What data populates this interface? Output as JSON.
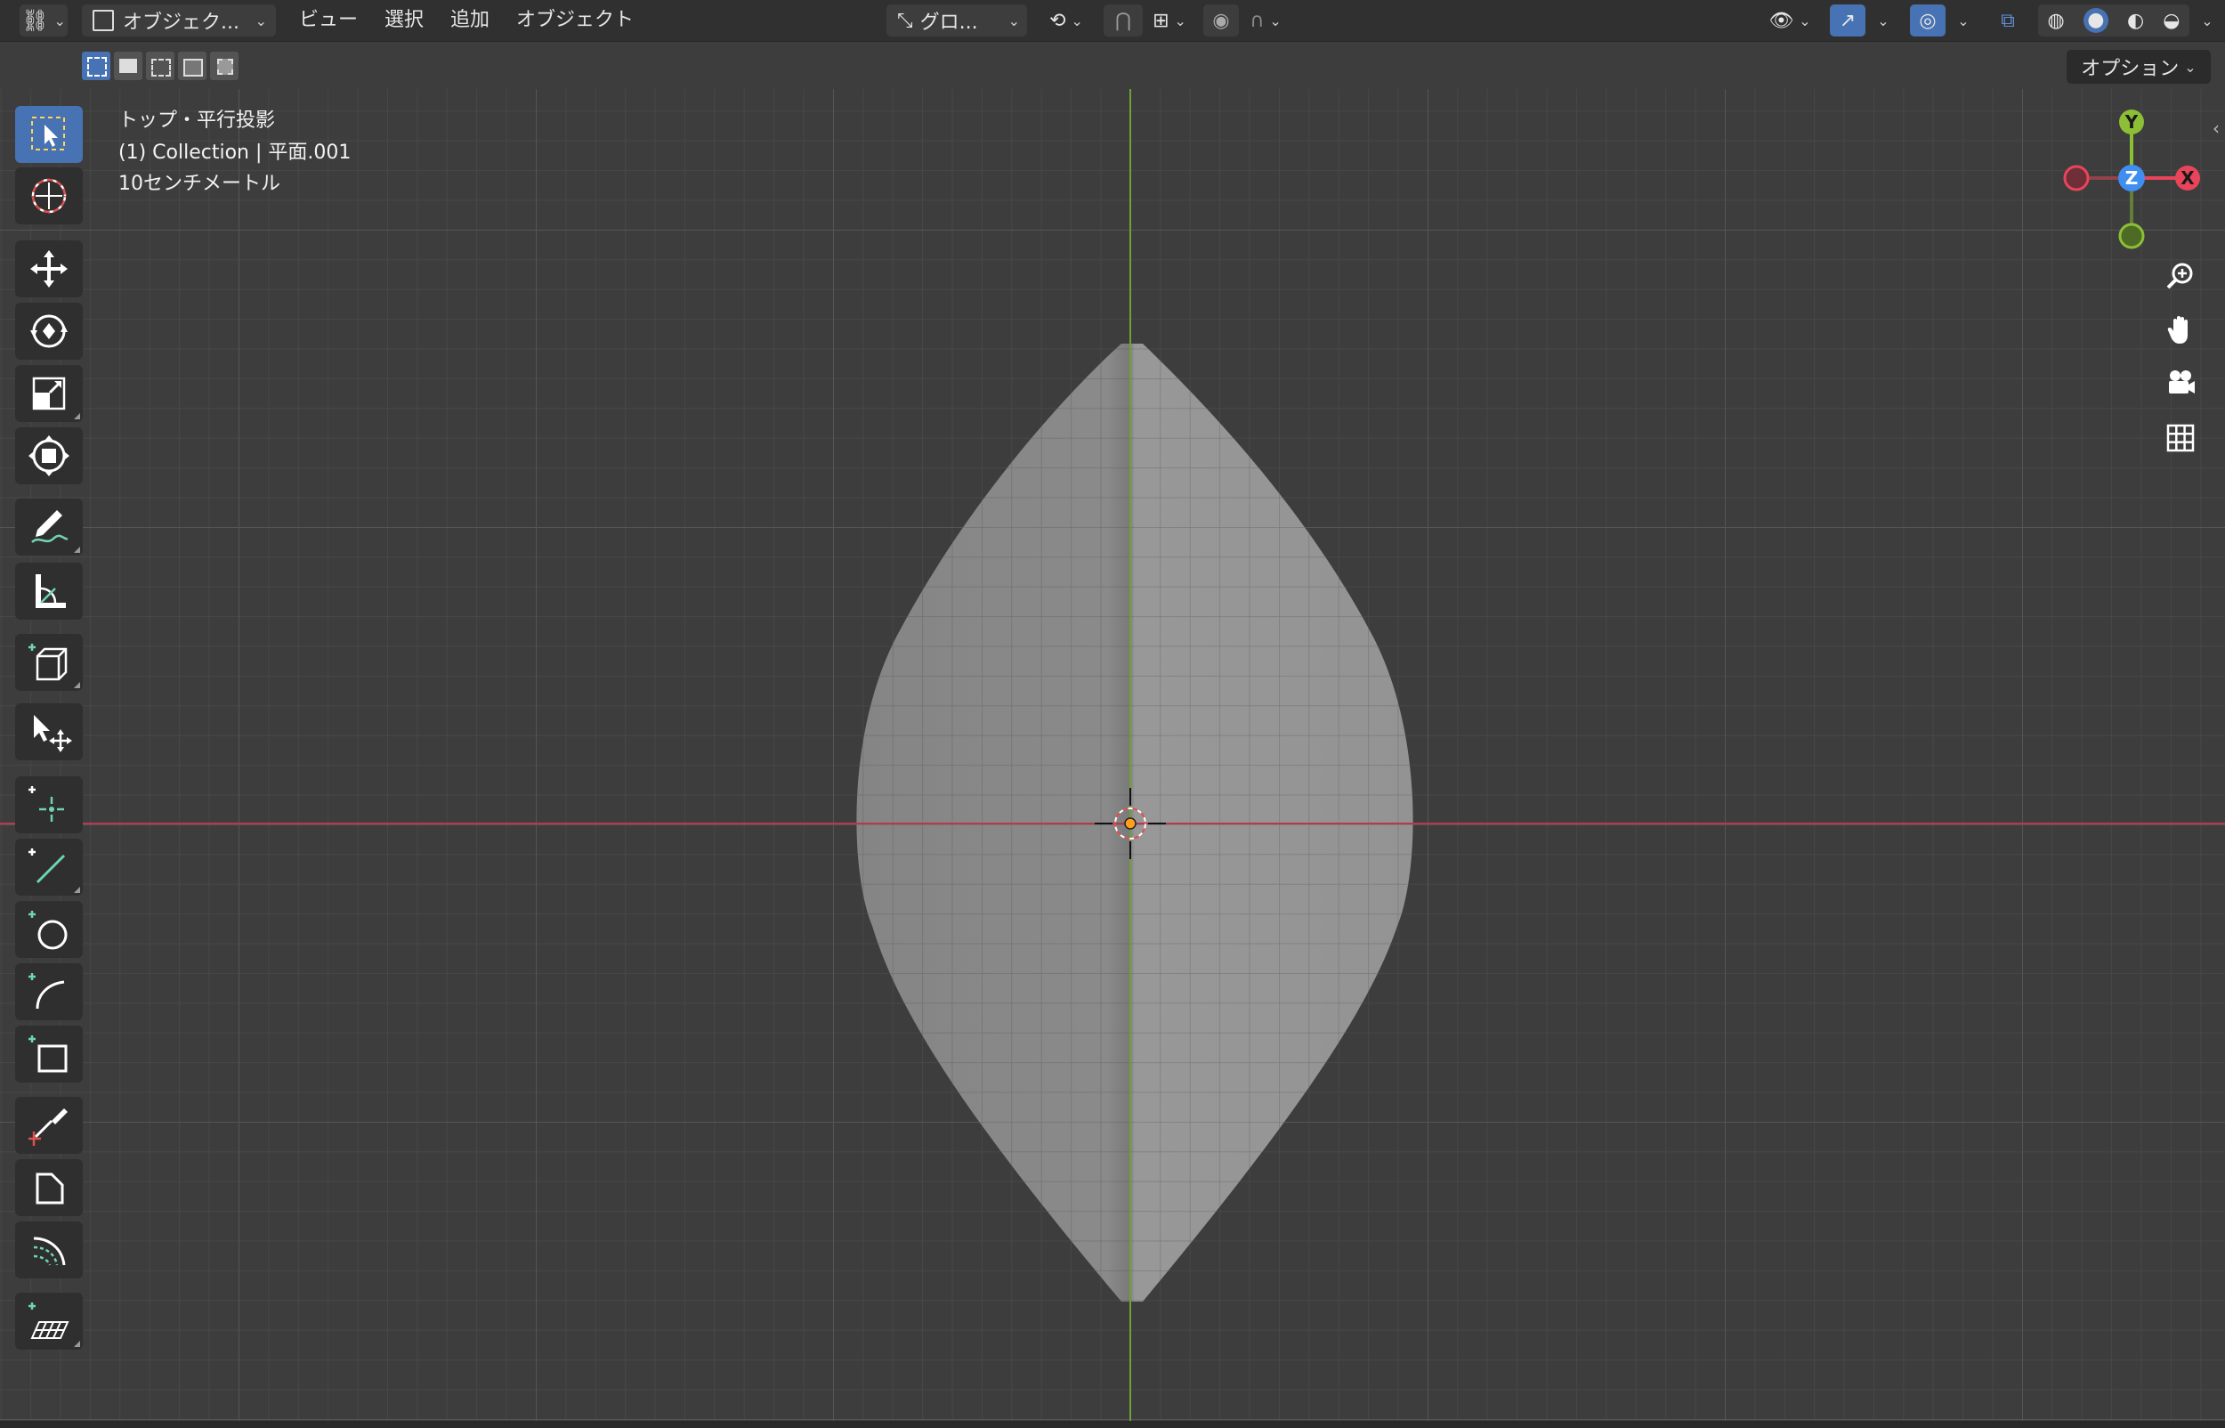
{
  "header": {
    "editor_type_icon": "viewport-editor-icon",
    "mode_label": "オブジェク...",
    "menus": [
      "ビュー",
      "選択",
      "追加",
      "オブジェクト"
    ],
    "orientation_label": "グロ...",
    "options_label": "オプション"
  },
  "overlay": {
    "view_name": "トップ・平行投影",
    "collection_label": "(1) Collection | 平面.001",
    "scale_label": "10センチメートル"
  },
  "gizmo": {
    "y_label": "Y",
    "z_label": "Z",
    "x_label": "X",
    "colors": {
      "x": "#e8455a",
      "y": "#8cbf35",
      "z": "#3f8ef0"
    }
  },
  "toolbar": {
    "tools": [
      "select-box-tool",
      "cursor-tool",
      "move-tool",
      "rotate-tool",
      "scale-tool",
      "transform-tool",
      "annotate-tool",
      "measure-tool",
      "add-cube-tool",
      "shrink-fatten-tool",
      "add-vertex-tool",
      "add-edge-tool",
      "add-circle-tool",
      "add-arc-tool",
      "add-plane-tool",
      "knife-tool",
      "bevel-tool",
      "spin-tool",
      "add-grid-tool"
    ]
  },
  "colors": {
    "accent": "#4772b3",
    "x_axis": "#b8394c",
    "y_axis": "#6fa033",
    "mesh": "#8c8c8c"
  }
}
